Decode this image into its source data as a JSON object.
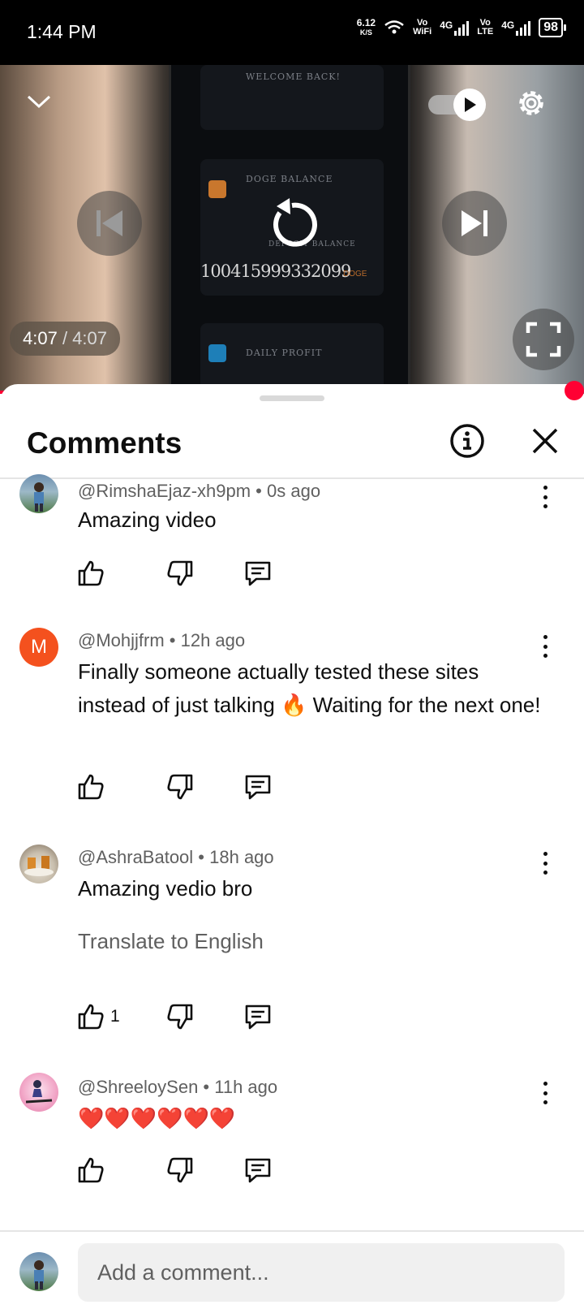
{
  "status_bar": {
    "time": "1:44 PM",
    "net_speed_value": "6.12",
    "net_speed_unit": "K/S",
    "sim1_label_top": "Vo",
    "sim1_label_bottom": "WiFi",
    "sim1_net": "4G",
    "sim2_label_top": "Vo",
    "sim2_label_bottom": "LTE",
    "sim2_net": "4G",
    "battery": "98"
  },
  "player": {
    "current_time": "4:07",
    "separator": " / ",
    "duration": "4:07",
    "progress": 1.0,
    "autoplay_on": true,
    "video_text": {
      "welcome": "WELCOME BACK!",
      "balance_label": "DOGE BALANCE",
      "deposit_label": "DEPOSIT BALANCE",
      "balance_value": "100415999332099",
      "currency": "DOGE",
      "profit_label": "DAILY PROFIT"
    }
  },
  "comments_sheet": {
    "title": "Comments",
    "comments": [
      {
        "author": "@RimshaEjaz-xh9pm",
        "time": "0s ago",
        "text": "Amazing video",
        "translate": "",
        "likes": ""
      },
      {
        "author": "@Mohjjfrm",
        "time": "12h ago",
        "text": "Finally someone actually tested these sites instead of just talking 🔥 Waiting for the next one!",
        "translate": "",
        "likes": "",
        "avatar_letter": "M"
      },
      {
        "author": "@AshraBatool",
        "time": "18h ago",
        "text": "Amazing vedio bro",
        "translate": "Translate to English",
        "likes": "1"
      },
      {
        "author": "@ShreeloySen",
        "time": "11h ago",
        "text": "❤️❤️❤️❤️❤️❤️",
        "translate": "",
        "likes": ""
      }
    ],
    "meta_separator": " • ",
    "add_comment_placeholder": "Add a comment..."
  },
  "colors": {
    "progress": "#ff0033",
    "avatar_m": "#f4511e",
    "text_primary": "#0f0f0f",
    "text_secondary": "#606060"
  },
  "icons": [
    "chevron-down-icon",
    "autoplay-toggle-icon",
    "gear-icon",
    "previous-icon",
    "replay-icon",
    "next-icon",
    "fullscreen-icon",
    "info-icon",
    "close-icon",
    "thumb-up-icon",
    "thumb-down-icon",
    "reply-icon",
    "more-vert-icon"
  ]
}
